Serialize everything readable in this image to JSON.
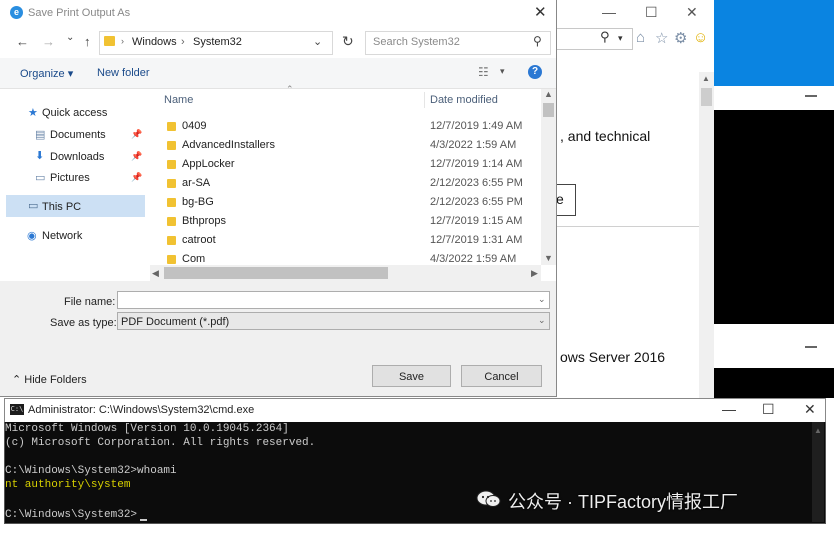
{
  "background_ie": {
    "text_line1": ", and technical",
    "box_text": "e",
    "text_line2": "ows Server 2016",
    "minimize": "—",
    "maximize": "☐",
    "close": "✕",
    "search_icon": "⚲",
    "dropdown": "▾",
    "home_icon": "⌂",
    "star_icon": "☆",
    "gear_icon": "⚙",
    "smile_icon": "☺",
    "scroll_up": "▲"
  },
  "dialog": {
    "title": "Save Print Output As",
    "close": "✕",
    "nav": {
      "back": "←",
      "forward": "→",
      "recent": "⌄",
      "up": "↑"
    },
    "path": [
      "Windows",
      "System32"
    ],
    "path_sep": "›",
    "path_dropdown": "⌄",
    "refresh": "↻",
    "search_placeholder": "Search System32",
    "search_icon": "⚲",
    "toolbar": {
      "organize": "Organize ▾",
      "new_folder": "New folder",
      "view_icon": "☷",
      "view_dd": "▾",
      "help": "?"
    },
    "nav_pane": {
      "quick_access": "Quick access",
      "documents": "Documents",
      "downloads": "Downloads",
      "pictures": "Pictures",
      "this_pc": "This PC",
      "network": "Network",
      "pin": "📌",
      "icons": {
        "quick": "★",
        "docs": "▤",
        "down": "⬇",
        "pics": "▭",
        "pc": "▭",
        "net": "◉"
      }
    },
    "columns": {
      "name": "Name",
      "date": "Date modified",
      "sort": "⌃"
    },
    "files": [
      {
        "name": "0409",
        "date": "12/7/2019 1:49 AM"
      },
      {
        "name": "AdvancedInstallers",
        "date": "4/3/2022 1:59 AM"
      },
      {
        "name": "AppLocker",
        "date": "12/7/2019 1:14 AM"
      },
      {
        "name": "ar-SA",
        "date": "2/12/2023 6:55 PM"
      },
      {
        "name": "bg-BG",
        "date": "2/12/2023 6:55 PM"
      },
      {
        "name": "Bthprops",
        "date": "12/7/2019 1:15 AM"
      },
      {
        "name": "catroot",
        "date": "12/7/2019 1:31 AM"
      },
      {
        "name": "Com",
        "date": "4/3/2022 1:59 AM"
      }
    ],
    "scroll": {
      "up": "▲",
      "down": "▼",
      "left": "◀",
      "right": "▶"
    },
    "file_name_label": "File name:",
    "file_name_value": "",
    "save_as_type_label": "Save as type:",
    "save_as_type_value": "PDF Document (*.pdf)",
    "field_dropdown": "⌄",
    "hide_folders": "⌃ Hide Folders",
    "save": "Save",
    "cancel": "Cancel"
  },
  "cmd": {
    "title": "Administrator: C:\\Windows\\System32\\cmd.exe",
    "icon": "C:\\",
    "minimize": "—",
    "maximize": "☐",
    "close": "✕",
    "lines": [
      "Microsoft Windows [Version 10.0.19045.2364]",
      "(c) Microsoft Corporation. All rights reserved.",
      "",
      "C:\\Windows\\System32>whoami",
      "nt authority\\system",
      "",
      "C:\\Windows\\System32>"
    ],
    "scroll_up": "▲"
  },
  "watermark": "公众号 · TIPFactory情报工厂"
}
